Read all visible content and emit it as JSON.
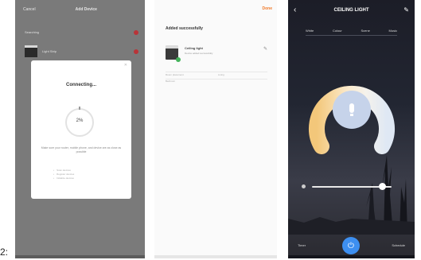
{
  "figure": {
    "label": "2:"
  },
  "screen1": {
    "topbar": {
      "left": "Cancel",
      "title": "Add Device",
      "right": ""
    },
    "rows": [
      {
        "label": "Searching"
      },
      {
        "label": "Light Strip"
      }
    ],
    "modal": {
      "title": "Connecting...",
      "progress_text": "2%",
      "progress": 0.02,
      "description": "Make sure your router, mobile phone, and device are as close as possible",
      "steps": [
        "Scan devices",
        "Register devices",
        "Initialize devices"
      ]
    }
  },
  "screen2": {
    "done_label": "Done",
    "added_heading": "Added successfully",
    "device": {
      "name": "Ceiling light",
      "subtitle": "Device added successfully",
      "status_color": "#43b35a"
    },
    "meta": [
      "Room placement",
      "Living",
      "Bedroom"
    ]
  },
  "screen3": {
    "title": "CEILING LIGHT",
    "tabs": [
      "White",
      "Colour",
      "Scene",
      "Music"
    ],
    "brightness": 0.88,
    "footer": {
      "left": "Timer",
      "right": "Schedule"
    },
    "accent_color": "#3d8ff0"
  }
}
